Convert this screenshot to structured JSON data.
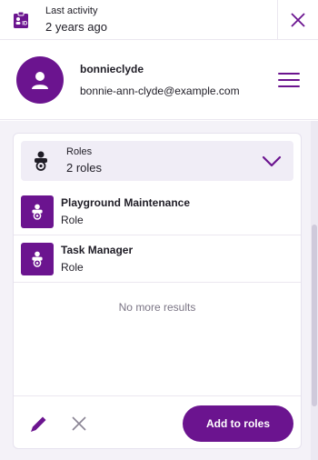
{
  "header": {
    "activity_label": "Last activity",
    "activity_value": "2 years ago",
    "id_icon": "id-card-icon",
    "close_icon": "close-icon"
  },
  "profile": {
    "username": "bonnieclyde",
    "email": "bonnie-ann-clyde@example.com",
    "avatar_icon": "user-icon",
    "menu_icon": "hamburger-menu-icon"
  },
  "roles_panel": {
    "title": "Roles",
    "count": "2 roles",
    "header_icon": "role-icon",
    "toggle_icon": "chevron-down-icon",
    "items": [
      {
        "name": "Playground Maintenance",
        "type": "Role",
        "icon": "role-icon"
      },
      {
        "name": "Task Manager",
        "type": "Role",
        "icon": "role-icon"
      }
    ],
    "empty_message": "No more results"
  },
  "footer": {
    "edit_icon": "pencil-icon",
    "clear_icon": "close-icon",
    "add_label": "Add to roles"
  },
  "colors": {
    "accent": "#6b148f",
    "panel_bg": "#f4f2f8",
    "header_bg": "#f0edf6",
    "muted_text": "#7b7585"
  }
}
